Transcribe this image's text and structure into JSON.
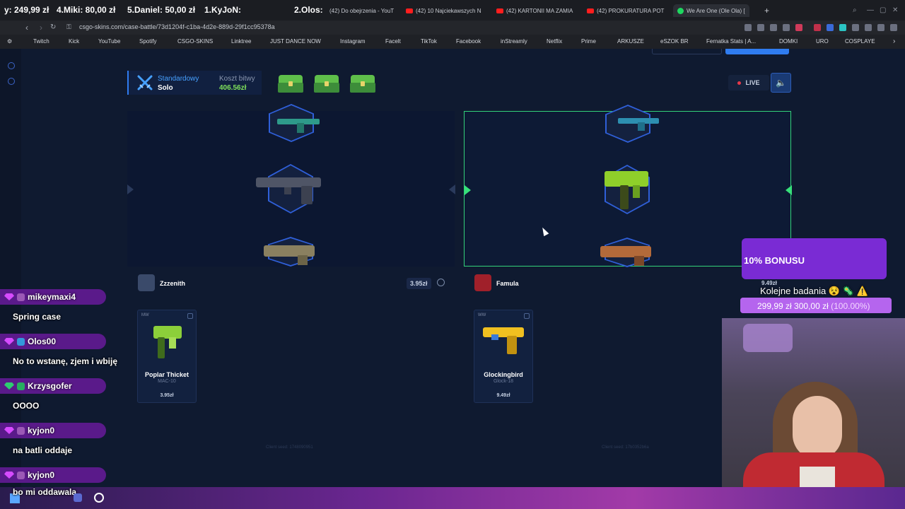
{
  "browser": {
    "ticker": [
      {
        "text": "y: 249,99 zł"
      },
      {
        "text": "4.Miki: 80,00 zł"
      },
      {
        "text": "5.Daniel: 50,00 zł"
      },
      {
        "text": "1.KyJoN:"
      },
      {
        "text": "2.Olos:"
      }
    ],
    "tabs": [
      {
        "label": "(42) Do obejrzenia - YouT",
        "icon": "youtube-icon"
      },
      {
        "label": "(42) 10 Najciekawszych N",
        "icon": "youtube-icon"
      },
      {
        "label": "(42) KARTONII MA ZAMIA",
        "icon": "youtube-icon"
      },
      {
        "label": "(42) PROKURATURA POT",
        "icon": "youtube-icon"
      },
      {
        "label": "We Are One (Ole Ola) [",
        "icon": "spotify-icon"
      }
    ],
    "new_tab_label": "+",
    "url": "csgo-skins.com/case-battle/73d1204f-c1ba-4d2e-889d-29f1cc95378a",
    "bookmarks": [
      {
        "label": "Twitch",
        "color": "#9146ff"
      },
      {
        "label": "Kick",
        "color": "#53fc18"
      },
      {
        "label": "YouTube",
        "color": "#ff0000"
      },
      {
        "label": "Spotify",
        "color": "#1ed760"
      },
      {
        "label": "CSGO-SKINS",
        "color": "#3c8cff"
      },
      {
        "label": "Linktree",
        "color": "#43e660"
      },
      {
        "label": "JUST DANCE NOW",
        "color": "#f0c040"
      },
      {
        "label": "Instagram",
        "color": "#e1306c"
      },
      {
        "label": "Facelt",
        "color": "#ff5500"
      },
      {
        "label": "TikTok",
        "color": "#ffffff"
      },
      {
        "label": "Facebook",
        "color": "#1877f2"
      },
      {
        "label": "inStreamly",
        "color": "#333333"
      },
      {
        "label": "Netflix",
        "color": "#e50914"
      },
      {
        "label": "Prime",
        "color": "#00a8e1"
      },
      {
        "label": "ARKUSZE",
        "color": "#888888"
      },
      {
        "label": "eSZOK BR",
        "color": "#2ecc40"
      },
      {
        "label": "Fernatka Stats | A...",
        "color": "#ff4444"
      },
      {
        "label": "DOMKI",
        "color": "#888888"
      },
      {
        "label": "URO",
        "color": "#888888"
      },
      {
        "label": "COSPLAYE",
        "color": "#888888"
      }
    ]
  },
  "battle": {
    "mode_label": "Standardowy",
    "mode_sub": "Solo",
    "cost_label": "Koszt bitwy",
    "cost_value": "406.56zł",
    "live_label": "LIVE",
    "players": [
      {
        "name": "Zzzenith",
        "value": "3.95zł",
        "item": {
          "wear": "MW",
          "name": "Poplar Thicket",
          "type": "MAC-10",
          "price": "3.95zł"
        },
        "client_seed": "Client seed: 1748090951"
      },
      {
        "name": "Famula",
        "value": "9.49zł",
        "item": {
          "wear": "WW",
          "name": "Glockingbird",
          "type": "Glock-18",
          "price": "9.49zł"
        },
        "client_seed": "Client seed: 17b0352b6a"
      }
    ]
  },
  "stream": {
    "chat": [
      {
        "user": "mikeymaxi4",
        "message": "Spring case",
        "badge_color": "#9b59b6"
      },
      {
        "user": "Olos00",
        "message": "No to wstanę, zjem i wbiję",
        "badge_color": "#3498db"
      },
      {
        "user": "Krzysgofer",
        "message": "OOOO",
        "badge_color": "#27ae60"
      },
      {
        "user": "kyjon0",
        "message": "na batli oddaje",
        "badge_color": "#9b59b6"
      },
      {
        "user": "kyjon0",
        "message": "bo mi oddawala",
        "badge_color": "#9b59b6"
      }
    ],
    "bonus": {
      "title": "10% BONUSU"
    },
    "goal": {
      "title": "Kolejne badania",
      "current": "299,99 zł",
      "target": "300,00 zł",
      "percent": "(100.00%)",
      "fraction": 1.0
    }
  }
}
